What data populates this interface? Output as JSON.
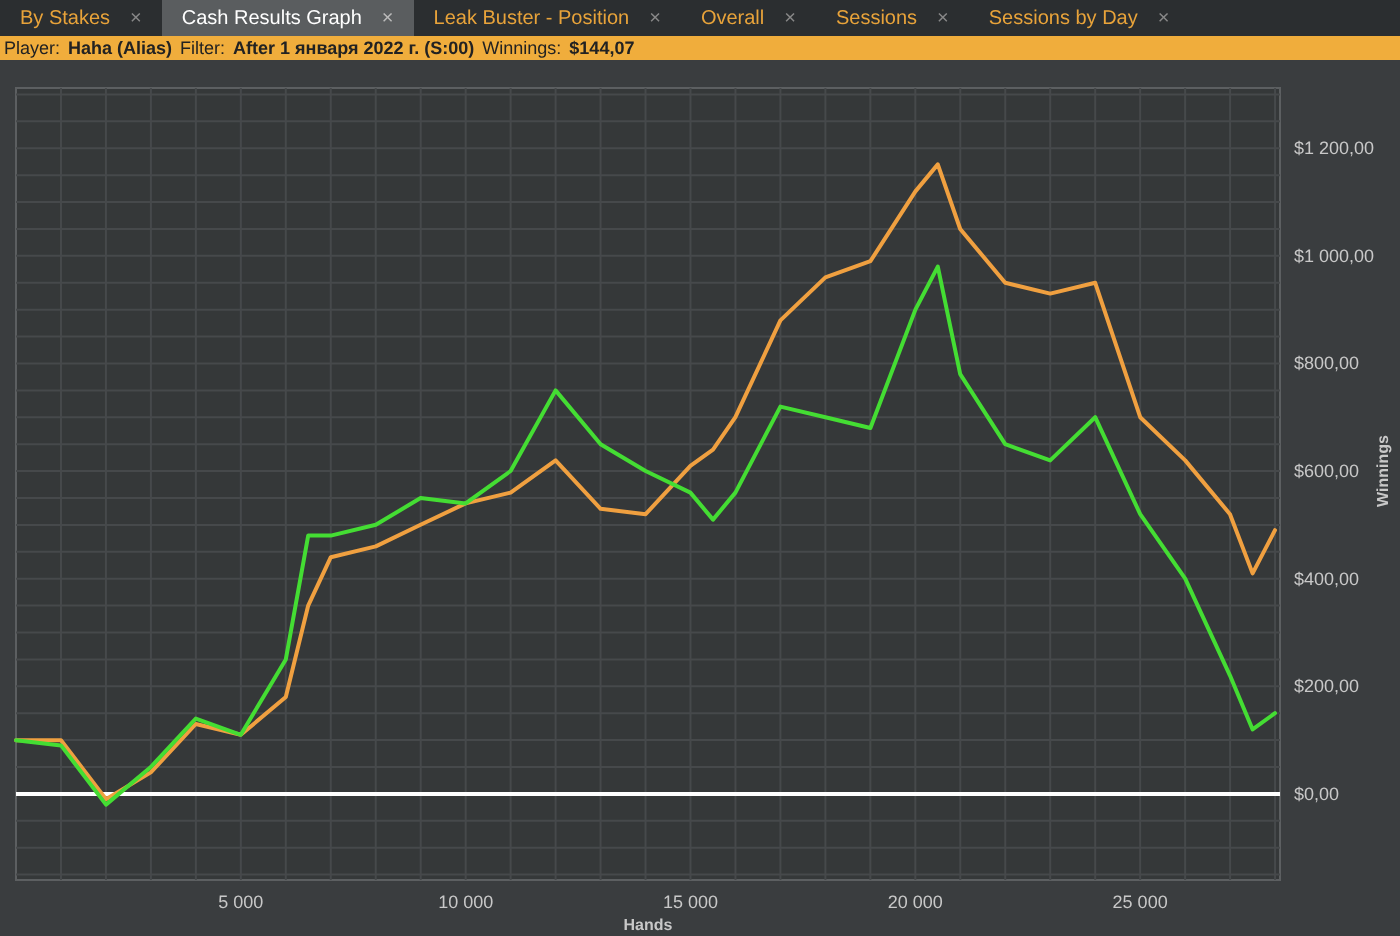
{
  "tabs": [
    {
      "label": "By Stakes",
      "close": "×",
      "selected": false
    },
    {
      "label": "Cash Results Graph",
      "close": "×",
      "selected": true
    },
    {
      "label": "Leak Buster - Position",
      "close": "×",
      "selected": false
    },
    {
      "label": "Overall",
      "close": "×",
      "selected": false
    },
    {
      "label": "Sessions",
      "close": "×",
      "selected": false
    },
    {
      "label": "Sessions by Day",
      "close": "×",
      "selected": false
    }
  ],
  "info_bar": [
    {
      "label": "Player:",
      "value": "Haha (Alias)"
    },
    {
      "label": "Filter:",
      "value": "After 1 января 2022 г. (S:00)"
    },
    {
      "label": "Winnings:",
      "value": "$144,07"
    }
  ],
  "chart_data": {
    "type": "line",
    "grid": true,
    "xlabel": "Hands",
    "ylabel": "Winnings",
    "x": [
      0,
      1000,
      2000,
      3000,
      4000,
      5000,
      6000,
      6500,
      7000,
      8000,
      9000,
      10000,
      11000,
      12000,
      13000,
      14000,
      15000,
      15500,
      16000,
      17000,
      18000,
      19000,
      20000,
      20500,
      21000,
      22000,
      23000,
      24000,
      25000,
      26000,
      27000,
      27500,
      28000
    ],
    "series": [
      {
        "color": "#f0a040",
        "values": [
          100,
          100,
          -10,
          40,
          130,
          110,
          180,
          350,
          440,
          460,
          500,
          540,
          560,
          620,
          530,
          520,
          610,
          640,
          700,
          880,
          960,
          990,
          1120,
          1170,
          1050,
          950,
          930,
          950,
          700,
          620,
          520,
          410,
          490
        ]
      },
      {
        "color": "#44dd33",
        "values": [
          100,
          90,
          -20,
          50,
          140,
          110,
          250,
          480,
          480,
          500,
          550,
          540,
          600,
          750,
          650,
          600,
          560,
          510,
          560,
          720,
          700,
          680,
          900,
          980,
          780,
          650,
          620,
          700,
          520,
          400,
          220,
          120,
          150
        ]
      }
    ],
    "xlim": [
      0,
      28110
    ],
    "ylim": [
      -160,
      1312
    ],
    "xticks": [
      {
        "value": 5000,
        "label": "5 000"
      },
      {
        "value": 10000,
        "label": "10 000"
      },
      {
        "value": 15000,
        "label": "15 000"
      },
      {
        "value": 20000,
        "label": "20 000"
      },
      {
        "value": 25000,
        "label": "25 000"
      }
    ],
    "yticks": [
      {
        "value": 0,
        "label": "$0,00"
      },
      {
        "value": 200,
        "label": "$200,00"
      },
      {
        "value": 400,
        "label": "$400,00"
      },
      {
        "value": 600,
        "label": "$600,00"
      },
      {
        "value": 800,
        "label": "$800,00"
      },
      {
        "value": 1000,
        "label": "$1 000,00"
      },
      {
        "value": 1200,
        "label": "$1 200,00"
      }
    ]
  }
}
